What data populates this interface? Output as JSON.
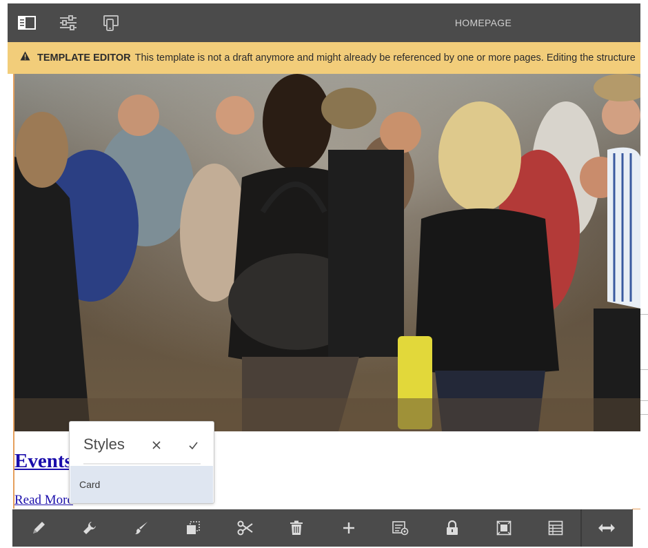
{
  "topbar": {
    "page_title": "HOMEPAGE",
    "buttons": [
      {
        "icon": "side-panel-icon"
      },
      {
        "icon": "page-properties-icon"
      },
      {
        "icon": "emulator-icon"
      }
    ]
  },
  "banner": {
    "label": "TEMPLATE EDITOR",
    "message": "This template is not a draft anymore and might already be referenced by one or more pages. Editing the structure"
  },
  "content": {
    "hero_alt": "crowd of people at an evening event",
    "title_link": "Events",
    "read_more": "Read More"
  },
  "styles_popover": {
    "title": "Styles",
    "options": [
      "Card"
    ],
    "close_icon": "close-icon",
    "confirm_icon": "checkmark-icon"
  },
  "edit_toolbar": {
    "buttons": [
      {
        "icon": "edit-pencil-icon"
      },
      {
        "icon": "configure-wrench-icon"
      },
      {
        "icon": "styles-brush-icon"
      },
      {
        "icon": "copy-icon"
      },
      {
        "icon": "cut-scissors-icon"
      },
      {
        "icon": "delete-trash-icon"
      },
      {
        "icon": "insert-plus-icon"
      },
      {
        "icon": "policy-icon"
      },
      {
        "icon": "lock-icon"
      },
      {
        "icon": "select-parent-icon"
      },
      {
        "icon": "layout-table-icon"
      },
      {
        "icon": "layout-resize-icon"
      }
    ]
  },
  "colors": {
    "toolbar_bg": "#4b4b4b",
    "banner_bg": "#f2cd7a",
    "link": "#1a0dab",
    "selected_option_bg": "#dfe6f1",
    "edit_border": "#e59f5c"
  }
}
